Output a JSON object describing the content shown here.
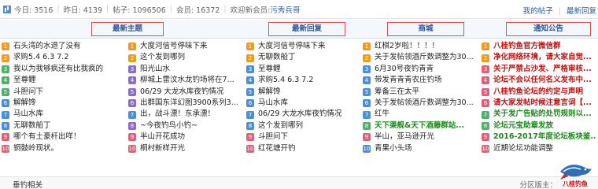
{
  "stats": {
    "today_label": "今日: 3516",
    "yesterday_label": "昨日: 4139",
    "posts_label": "帖子: 1096506",
    "members_label": "会员: 16372",
    "welcome_prefix": "欢迎新会员:",
    "new_member": "污秀兵哥",
    "my_posts": "我的帖子",
    "latest_reply": "最新回复"
  },
  "tabs": [
    "最新主题",
    "最新回复",
    "商城",
    "通知公告"
  ],
  "columns": [
    [
      {
        "text": "石头湾的水退了没有",
        "num": "1",
        "color": "or",
        "style": ""
      },
      {
        "text": "求购5.4 6.3 7.2",
        "num": "2",
        "color": "or",
        "style": ""
      },
      {
        "text": "我以为我够疯还有比我疯的",
        "num": "3",
        "color": "gr",
        "style": ""
      },
      {
        "text": "至尊鲤",
        "num": "4",
        "color": "gr",
        "style": ""
      },
      {
        "text": "斗胆问下",
        "num": "5",
        "color": "gr",
        "style": ""
      },
      {
        "text": "解解馋",
        "num": "6",
        "color": "bl",
        "style": ""
      },
      {
        "text": "马山水库",
        "num": "7",
        "color": "bl",
        "style": ""
      },
      {
        "text": "无聊数船丁",
        "num": "8",
        "color": "bl",
        "style": ""
      },
      {
        "text": "哪个有土豪杆出咩！",
        "num": "9",
        "color": "pk",
        "style": ""
      },
      {
        "text": "铜鼓岭现状。",
        "num": "10",
        "color": "pk",
        "style": ""
      }
    ],
    [
      {
        "text": "大度河信号停味下来",
        "num": "1",
        "color": "or",
        "style": ""
      },
      {
        "text": "这个发到哪列",
        "num": "2",
        "color": "or",
        "style": ""
      },
      {
        "text": "阳光山水",
        "num": "3",
        "color": "pu",
        "style": ""
      },
      {
        "text": "柳城上雷汶水龙钓场将在7...",
        "num": "4",
        "color": "pu",
        "style": ""
      },
      {
        "text": "06/29 大龙水库夜钓情况",
        "num": "5",
        "color": "pu",
        "style": ""
      },
      {
        "text": "出群国东洋幻图3900系列3...",
        "num": "6",
        "color": "pu",
        "style": ""
      },
      {
        "text": "出，战斗漂！东承漂！",
        "num": "7",
        "color": "bl",
        "style": ""
      },
      {
        "text": "~今夜钓鸟小钓~",
        "num": "8",
        "color": "pu",
        "style": ""
      },
      {
        "text": "半山开花成功",
        "num": "9",
        "color": "pk",
        "style": ""
      },
      {
        "text": "桐村新样开光",
        "num": "10",
        "color": "pk",
        "style": ""
      }
    ],
    [
      {
        "text": "大度河信号停味下来",
        "num": "1",
        "color": "or",
        "style": ""
      },
      {
        "text": "无聊数船丁",
        "num": "2",
        "color": "or",
        "style": ""
      },
      {
        "text": "至尊鲤",
        "num": "3",
        "color": "bl",
        "style": ""
      },
      {
        "text": "求购5.4 6.3 7.2",
        "num": "4",
        "color": "bl",
        "style": ""
      },
      {
        "text": "解解馋",
        "num": "5",
        "color": "bl",
        "style": ""
      },
      {
        "text": "马山水库",
        "num": "6",
        "color": "bl",
        "style": ""
      },
      {
        "text": "06/29 大龙水库夜钓情况",
        "num": "7",
        "color": "bl",
        "style": ""
      },
      {
        "text": "这个发到哪列",
        "num": "8",
        "color": "bl",
        "style": ""
      },
      {
        "text": "斗胆问下",
        "num": "9",
        "color": "pk",
        "style": ""
      },
      {
        "text": "红花塘开钓",
        "num": "10",
        "color": "pk",
        "style": ""
      }
    ],
    [
      {
        "text": "红棋2岁啦！！！！",
        "num": "1",
        "color": "or",
        "style": ""
      },
      {
        "text": "关于发帖领酒斤数调整为30...",
        "num": "2",
        "color": "or",
        "style": ""
      },
      {
        "text": "6月30号夜钓青青",
        "num": "3",
        "color": "bl",
        "style": ""
      },
      {
        "text": "带发青青青农庄钓场",
        "num": "4",
        "color": "bl",
        "style": ""
      },
      {
        "text": "筹备三在太平",
        "num": "5",
        "color": "bl",
        "style": ""
      },
      {
        "text": "关于发帖领酒斤数调整为30...",
        "num": "6",
        "color": "bl",
        "style": ""
      },
      {
        "text": "红牛",
        "num": "7",
        "color": "bl",
        "style": ""
      },
      {
        "text": "天下渠舰&天下酒藤群站...",
        "num": "8",
        "color": "gr",
        "style": "green"
      },
      {
        "text": "半山，亚马逊开光",
        "num": "9",
        "color": "pk",
        "style": ""
      },
      {
        "text": "青果小头场",
        "num": "10",
        "color": "bl",
        "style": ""
      }
    ],
    [
      {
        "text": "八桂钓鱼官方微信群",
        "num": "1",
        "color": "or",
        "style": "red"
      },
      {
        "text": "净化网络环境，请大家自觉...",
        "num": "2",
        "color": "or",
        "style": "red"
      },
      {
        "text": "关于严禁占沙发、严格审核...",
        "num": "3",
        "color": "pk",
        "style": "red"
      },
      {
        "text": "论坛不会以任何名义发布中...",
        "num": "4",
        "color": "pk",
        "style": "red"
      },
      {
        "text": "八桂钓鱼论坛的约定与声明",
        "num": "5",
        "color": "pk",
        "style": "red"
      },
      {
        "text": "请大家发帖时候注意言词【...",
        "num": "6",
        "color": "pk",
        "style": "red"
      },
      {
        "text": "关于发广告贴的处罚规则以...",
        "num": "7",
        "color": "gr",
        "style": "green"
      },
      {
        "text": "论坛元宝助章发放",
        "num": "8",
        "color": "gr",
        "style": "green"
      },
      {
        "text": "2016-2017年度论坛板块鉴...",
        "num": "9",
        "color": "pk",
        "style": "green"
      },
      {
        "text": "近期论坛功能调整",
        "num": "10",
        "color": "pk",
        "style": ""
      }
    ]
  ],
  "footer": {
    "left": "垂钓相关",
    "right": "分区版主：",
    "logo_text": "八桂钓鱼"
  }
}
